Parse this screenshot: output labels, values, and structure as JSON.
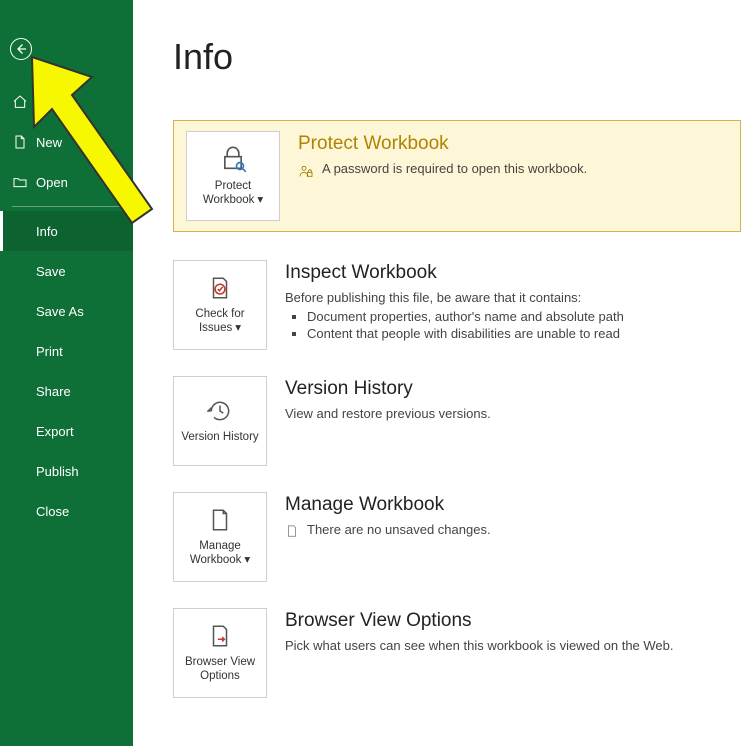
{
  "sidebar": {
    "home": "Home",
    "new": "New",
    "open": "Open",
    "info": "Info",
    "save": "Save",
    "saveAs": "Save As",
    "print": "Print",
    "share": "Share",
    "export": "Export",
    "publish": "Publish",
    "close": "Close"
  },
  "page": {
    "title": "Info"
  },
  "protect": {
    "tileLabel": "Protect Workbook",
    "heading": "Protect Workbook",
    "desc": "A password is required to open this workbook."
  },
  "inspect": {
    "tileLabel": "Check for Issues",
    "heading": "Inspect Workbook",
    "desc": "Before publishing this file, be aware that it contains:",
    "items": [
      "Document properties, author's name and absolute path",
      "Content that people with disabilities are unable to read"
    ]
  },
  "version": {
    "tileLabel": "Version History",
    "heading": "Version History",
    "desc": "View and restore previous versions."
  },
  "manage": {
    "tileLabel": "Manage Workbook",
    "heading": "Manage Workbook",
    "desc": "There are no unsaved changes."
  },
  "browser": {
    "tileLabel": "Browser View Options",
    "heading": "Browser View Options",
    "desc": "Pick what users can see when this workbook is viewed on the Web."
  },
  "colors": {
    "sidebarBg": "#0f7037",
    "highlightBg": "#fdf6d7",
    "highlightBorder": "#d6b24a",
    "protectHeading": "#b08400"
  }
}
